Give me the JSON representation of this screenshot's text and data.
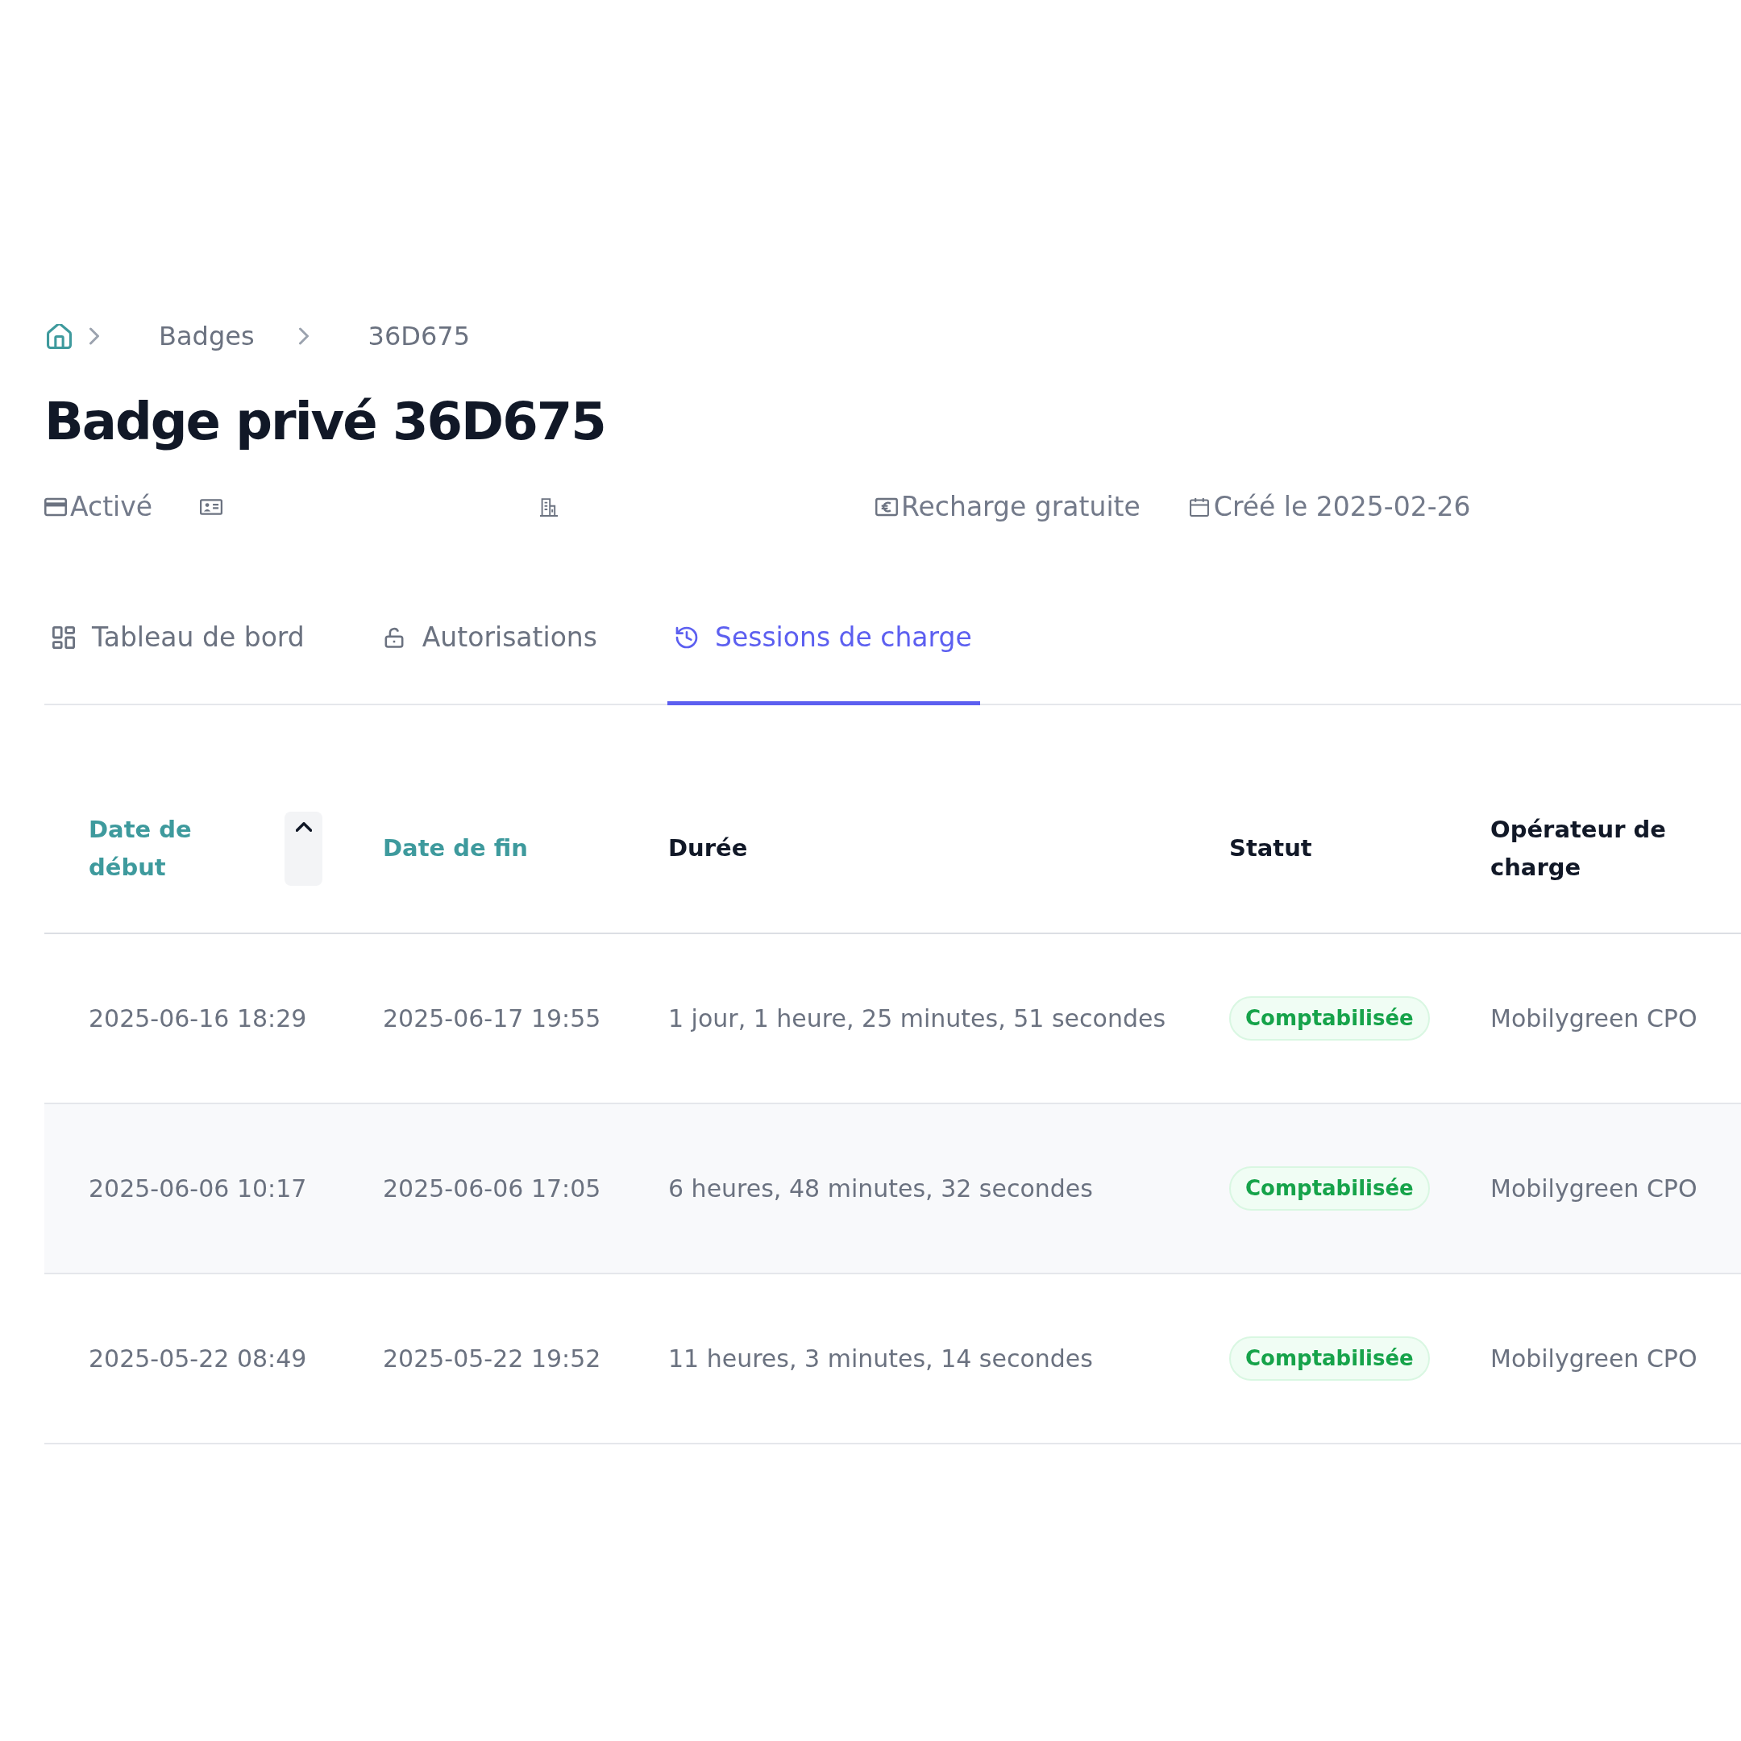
{
  "breadcrumb": [
    "Badges",
    "36D675"
  ],
  "title": "Badge privé 36D675",
  "meta": [
    {
      "kind": "status",
      "text": "Activé"
    },
    {
      "kind": "holder"
    },
    {
      "kind": "company"
    },
    {
      "kind": "pricing",
      "text": "Recharge gratuite"
    },
    {
      "kind": "created",
      "text": "Créé le 2025-02-26"
    }
  ],
  "tabs": [
    {
      "kind": "dashboard",
      "label": "Tableau de bord",
      "selected": false
    },
    {
      "kind": "authorizations",
      "label": "Autorisations",
      "selected": false
    },
    {
      "kind": "sessions",
      "label": "Sessions de charge",
      "selected": true
    }
  ],
  "table": {
    "columns": [
      {
        "label": "Date de début",
        "kind": "text",
        "sortable": true,
        "sorted": true
      },
      {
        "label": "Date de fin",
        "kind": "text",
        "sortable": true,
        "sorted": false
      },
      {
        "label": "Durée",
        "kind": "text",
        "sortable": false,
        "sorted": false
      },
      {
        "label": "Statut",
        "kind": "badge",
        "sortable": false,
        "sorted": false
      },
      {
        "label": "Opérateur de charge",
        "kind": "text",
        "sortable": false,
        "sorted": false
      }
    ],
    "rows": [
      {
        "cells": [
          "2025-06-16 18:29",
          "2025-06-17 19:55",
          "1 jour, 1 heure, 25 minutes, 51 secondes",
          "Comptabilisée",
          "Mobilygreen CPO"
        ]
      },
      {
        "cells": [
          "2025-06-06 10:17",
          "2025-06-06 17:05",
          "6 heures, 48 minutes, 32 secondes",
          "Comptabilisée",
          "Mobilygreen CPO"
        ]
      },
      {
        "cells": [
          "2025-05-22 08:49",
          "2025-05-22 19:52",
          "11 heures, 3 minutes, 14 secondes",
          "Comptabilisée",
          "Mobilygreen CPO"
        ]
      }
    ]
  }
}
